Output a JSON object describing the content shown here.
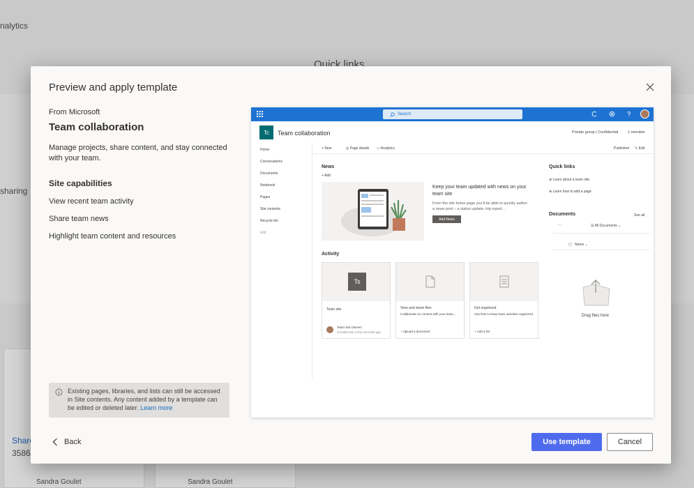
{
  "background": {
    "analytics_text": "nalytics",
    "quick_links_text": "Quick links",
    "sharing_text": "sharing",
    "shared_text": "Shared",
    "count_text": "3586",
    "user_name_1": "Sandra Goulet",
    "user_name_2": "Sandra Goulet"
  },
  "modal": {
    "title": "Preview and apply template",
    "from": "From Microsoft",
    "template_name": "Team collaboration",
    "description": "Manage projects, share content, and stay connected with your team.",
    "capabilities_heading": "Site capabilities",
    "capabilities": [
      "View recent team activity",
      "Share team news",
      "Highlight team content and resources"
    ],
    "note_text": "Existing pages, libraries, and lists can still be accessed in Site contents. Any content added by a template can be edited or deleted later.",
    "note_link": "Learn more",
    "back_label": "Back",
    "use_label": "Use template",
    "cancel_label": "Cancel"
  },
  "preview": {
    "search_placeholder": "Search",
    "site_initials": "Tc",
    "site_title": "Team collaboration",
    "site_meta": "Private group | Confidential",
    "members": "1 member",
    "nav": [
      "Home",
      "Conversations",
      "Documents",
      "Notebook",
      "Pages",
      "Site contents",
      "Recycle bin",
      "Edit"
    ],
    "cmd_new": "New",
    "cmd_page_details": "Page details",
    "cmd_analytics": "Analytics",
    "published": "Published",
    "edit": "Edit",
    "news_heading": "News",
    "add_label": "Add",
    "news_title": "Keep your team updated with news on your team site",
    "news_body": "From the site home page you'll be able to quickly author a news post – a status update, trip report…",
    "add_news": "Add News",
    "activity_heading": "Activity",
    "tile1_initials": "Ts",
    "tile1_title": "Team site",
    "tile1_owner": "Team site Owners",
    "tile1_created": "Created site a few seconds ago",
    "tile2_title": "View and share files",
    "tile2_body": "Collaborate on content with your team...",
    "tile2_action": "Upload a document",
    "tile3_title": "Get organized",
    "tile3_body": "Use lists to keep team activities organized.",
    "tile3_action": "Add a list",
    "quicklinks_heading": "Quick links",
    "ql1": "Learn about a team site",
    "ql2": "Learn how to add a page",
    "documents_heading": "Documents",
    "see_all": "See all",
    "all_documents": "All Documents",
    "name_col": "Name",
    "drag_text": "Drag files here"
  },
  "colors": {
    "accent": "#4f6bed",
    "suite_bar": "#1e73d2",
    "site_logo": "#036c70"
  }
}
